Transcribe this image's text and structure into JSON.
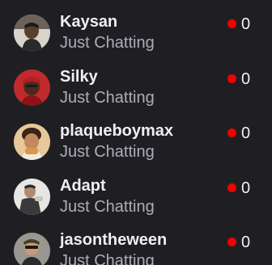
{
  "channels": [
    {
      "name": "Kaysan",
      "category": "Just Chatting",
      "viewers": "0",
      "avatar_icon": "streamer-avatar-icon"
    },
    {
      "name": "Silky",
      "category": "Just Chatting",
      "viewers": "0",
      "avatar_icon": "streamer-avatar-icon"
    },
    {
      "name": "plaqueboymax",
      "category": "Just Chatting",
      "viewers": "0",
      "avatar_icon": "streamer-avatar-icon"
    },
    {
      "name": "Adapt",
      "category": "Just Chatting",
      "viewers": "0",
      "avatar_icon": "streamer-avatar-icon"
    },
    {
      "name": "jasontheween",
      "category": "Just Chatting",
      "viewers": "0",
      "avatar_icon": "streamer-avatar-icon"
    }
  ],
  "colors": {
    "background": "#1f1f23",
    "live": "#eb0400",
    "name_text": "#efeff1",
    "category_text": "#adadb8"
  }
}
